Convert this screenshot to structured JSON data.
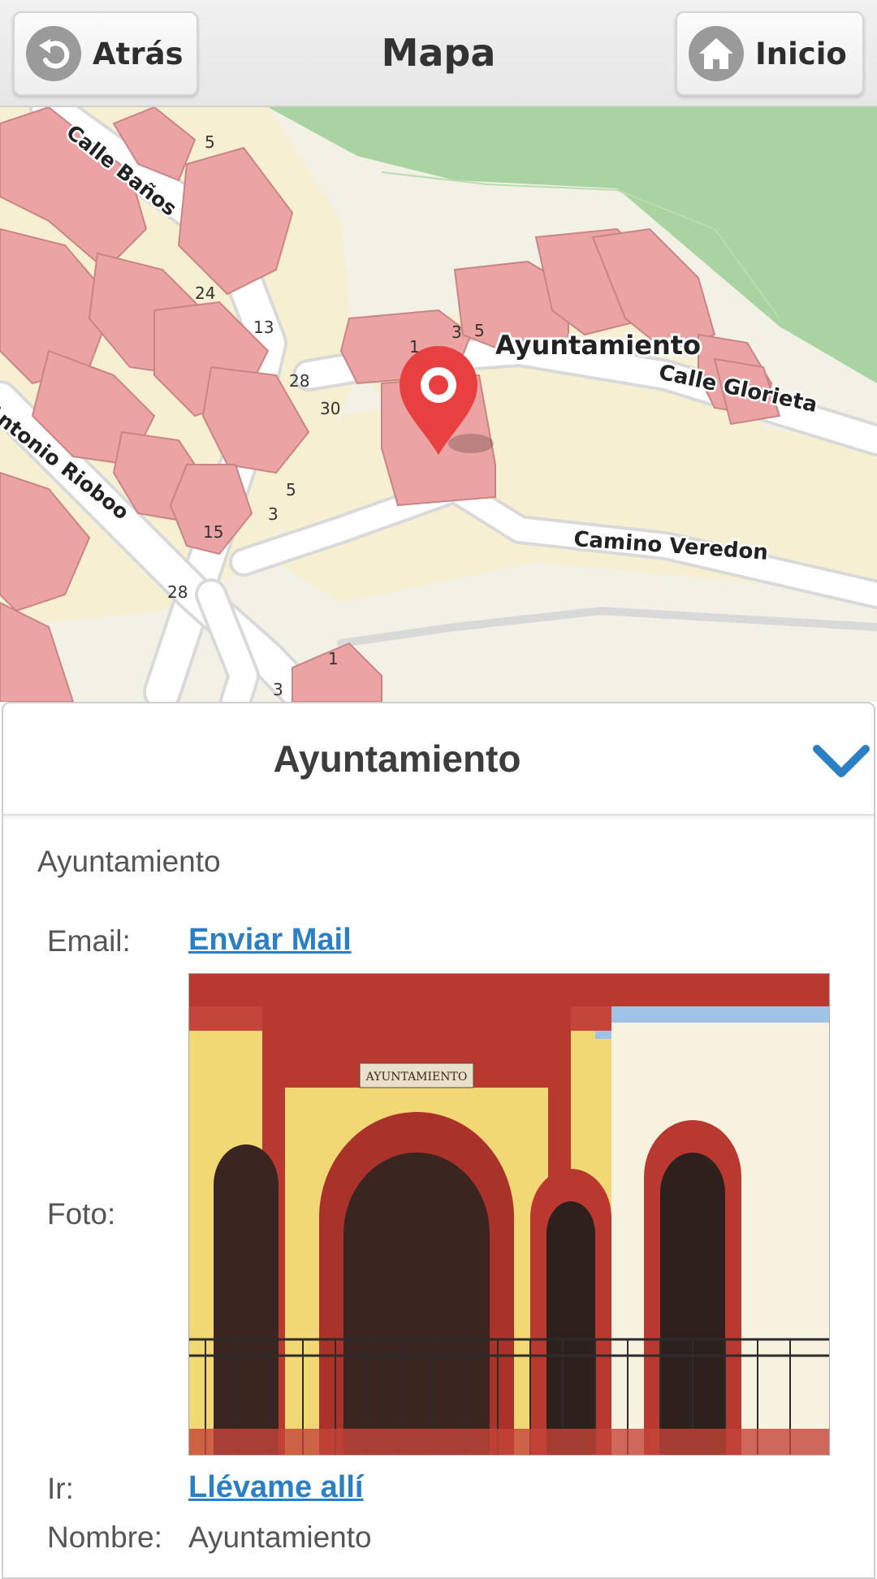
{
  "header": {
    "back_label": "Atrás",
    "title": "Mapa",
    "home_label": "Inicio"
  },
  "map": {
    "pin_label": "Ayuntamiento",
    "streets": [
      "Calle Baños",
      "Antonio Rioboo",
      "Calle Glorieta",
      "Camino Veredon"
    ],
    "house_numbers": [
      "5",
      "24",
      "13",
      "28",
      "30",
      "5",
      "3",
      "15",
      "28",
      "1",
      "3",
      "3",
      "5",
      "1"
    ],
    "pin_color": "#e84040"
  },
  "panel": {
    "title": "Ayuntamiento",
    "subtitle": "Ayuntamiento",
    "email_label": "Email:",
    "email_link": "Enviar Mail",
    "photo_label": "Foto:",
    "photo_sign": "AYUNTAMIENTO",
    "go_label": "Ir:",
    "go_link": "Llévame allí",
    "name_label": "Nombre:",
    "name_value": "Ayuntamiento"
  },
  "colors": {
    "accent": "#2a7fc5",
    "building": "#eba3a3",
    "park": "#a9d3a0"
  }
}
